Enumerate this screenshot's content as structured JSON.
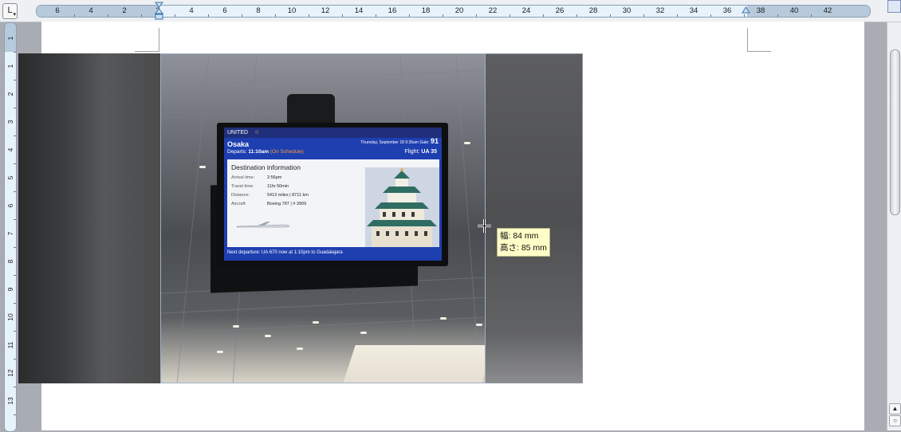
{
  "ruler": {
    "tab_selector": "L",
    "horizontal_labels": [
      "6",
      "4",
      "2",
      "2",
      "4",
      "6",
      "8",
      "10",
      "12",
      "14",
      "16",
      "18",
      "20",
      "22",
      "24",
      "26",
      "28",
      "30",
      "32",
      "34",
      "36",
      "38",
      "40",
      "42"
    ],
    "vertical_labels": [
      "1",
      "1",
      "2",
      "3",
      "4",
      "5",
      "6",
      "7",
      "8",
      "9",
      "10",
      "11",
      "12",
      "13"
    ]
  },
  "photo": {
    "screen": {
      "airline": "UNITED",
      "date": "Thursday, September 18 9:36am",
      "gate_label": "Gate:",
      "gate": "91",
      "city": "Osaka",
      "departs_label": "Departs:",
      "departs_time": "11:10am",
      "status": "(On Schedule)",
      "flight_label": "Flight:",
      "flight": "UA 35",
      "panel_heading": "Destination information",
      "rows": [
        {
          "label": "Arrival time:",
          "value": "2:56pm"
        },
        {
          "label": "Travel time:",
          "value": "11hr 50min"
        },
        {
          "label": "Distance:",
          "value": "5413 miles | 8711 km"
        },
        {
          "label": "Aircraft:",
          "value": "Boeing 787 | # 3909"
        }
      ],
      "next_departure": "Next departure: UA 670 now at 1:10pm to Guadalajara"
    }
  },
  "tooltip": {
    "width_line": "幅:  84 mm",
    "height_line": "高さ:  85 mm"
  },
  "colors": {
    "page": "#ffffff",
    "workspace": "#a9acb3",
    "ruler": "#e7f2fb",
    "tooltip_bg": "#fefdc7",
    "screen_blue": "#1e3fb0"
  }
}
